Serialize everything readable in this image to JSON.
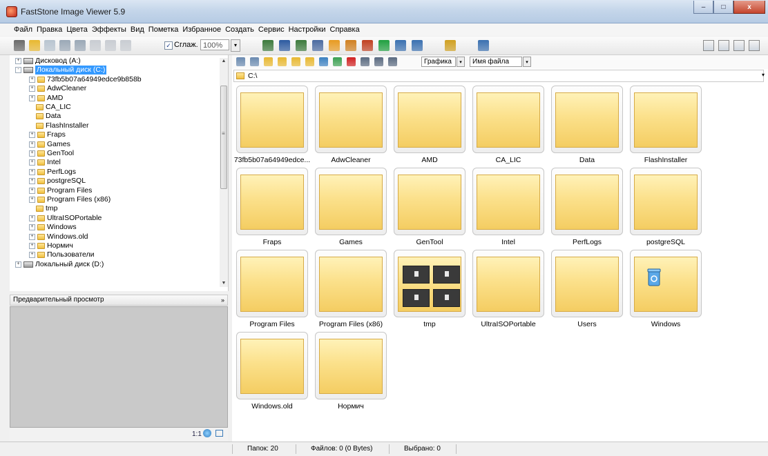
{
  "window": {
    "title": "FastStone Image Viewer 5.9"
  },
  "window_controls": {
    "minimize": "–",
    "maximize": "□",
    "close": "x"
  },
  "menu": [
    "Файл",
    "Правка",
    "Цвета",
    "Эффекты",
    "Вид",
    "Пометка",
    "Избранное",
    "Создать",
    "Сервис",
    "Настройки",
    "Справка"
  ],
  "toolbar": {
    "smooth_check": "✓",
    "smooth_label": "Сглаж.",
    "zoom_value": "100%",
    "dropdown_arrow": "▾"
  },
  "tree": {
    "items": [
      {
        "label": "Дисковод (A:)",
        "type": "drive",
        "indent": 0,
        "expander": "+"
      },
      {
        "label": "Локальный диск (C:)",
        "type": "drive",
        "indent": 0,
        "expander": "-",
        "selected": true
      },
      {
        "label": "73fb5b07a64949edce9b858b",
        "type": "folder",
        "indent": 1,
        "expander": "+"
      },
      {
        "label": "AdwCleaner",
        "type": "folder",
        "indent": 1,
        "expander": "+"
      },
      {
        "label": "AMD",
        "type": "folder",
        "indent": 1,
        "expander": "+"
      },
      {
        "label": "CA_LIC",
        "type": "folder",
        "indent": 1,
        "expander": ""
      },
      {
        "label": "Data",
        "type": "folder",
        "indent": 1,
        "expander": ""
      },
      {
        "label": "FlashInstaller",
        "type": "folder",
        "indent": 1,
        "expander": ""
      },
      {
        "label": "Fraps",
        "type": "folder",
        "indent": 1,
        "expander": "+"
      },
      {
        "label": "Games",
        "type": "folder",
        "indent": 1,
        "expander": "+"
      },
      {
        "label": "GenTool",
        "type": "folder",
        "indent": 1,
        "expander": "+"
      },
      {
        "label": "Intel",
        "type": "folder",
        "indent": 1,
        "expander": "+"
      },
      {
        "label": "PerfLogs",
        "type": "folder",
        "indent": 1,
        "expander": "+"
      },
      {
        "label": "postgreSQL",
        "type": "folder",
        "indent": 1,
        "expander": "+"
      },
      {
        "label": "Program Files",
        "type": "folder",
        "indent": 1,
        "expander": "+"
      },
      {
        "label": "Program Files (x86)",
        "type": "folder",
        "indent": 1,
        "expander": "+"
      },
      {
        "label": "tmp",
        "type": "folder",
        "indent": 1,
        "expander": ""
      },
      {
        "label": "UltraISOPortable",
        "type": "folder",
        "indent": 1,
        "expander": "+"
      },
      {
        "label": "Windows",
        "type": "folder",
        "indent": 1,
        "expander": "+"
      },
      {
        "label": "Windows.old",
        "type": "folder",
        "indent": 1,
        "expander": "+"
      },
      {
        "label": "Нормич",
        "type": "folder",
        "indent": 1,
        "expander": "+"
      },
      {
        "label": "Пользователи",
        "type": "folder",
        "indent": 1,
        "expander": "+"
      },
      {
        "label": "Локальный диск (D:)",
        "type": "drive",
        "indent": 0,
        "expander": "+"
      }
    ],
    "scroll_up": "▲",
    "scroll_down": "▼",
    "scroll_grip": "≡"
  },
  "preview": {
    "title": "Предварительный просмотр",
    "collapse_icon": "»",
    "actual_size": "1:1"
  },
  "browser": {
    "sort_type": "Графика",
    "sort_field": "Имя файла",
    "path": "C:\\",
    "folders": [
      {
        "name": "73fb5b07a64949edce...",
        "kind": "folder"
      },
      {
        "name": "AdwCleaner",
        "kind": "folder"
      },
      {
        "name": "AMD",
        "kind": "folder"
      },
      {
        "name": "CA_LIC",
        "kind": "folder"
      },
      {
        "name": "Data",
        "kind": "folder"
      },
      {
        "name": "FlashInstaller",
        "kind": "folder"
      },
      {
        "name": "Fraps",
        "kind": "folder"
      },
      {
        "name": "Games",
        "kind": "folder"
      },
      {
        "name": "GenTool",
        "kind": "folder"
      },
      {
        "name": "Intel",
        "kind": "folder"
      },
      {
        "name": "PerfLogs",
        "kind": "folder"
      },
      {
        "name": "postgreSQL",
        "kind": "folder"
      },
      {
        "name": "Program Files",
        "kind": "folder"
      },
      {
        "name": "Program Files (x86)",
        "kind": "folder"
      },
      {
        "name": "tmp",
        "kind": "tmp"
      },
      {
        "name": "UltraISOPortable",
        "kind": "folder"
      },
      {
        "name": "Users",
        "kind": "folder"
      },
      {
        "name": "Windows",
        "kind": "recycle"
      },
      {
        "name": "Windows.old",
        "kind": "folder"
      },
      {
        "name": "Нормич",
        "kind": "folder"
      }
    ]
  },
  "status": {
    "folders": "Папок: 20",
    "files": "Файлов: 0 (0 Bytes)",
    "selected": "Выбрано: 0"
  },
  "colors": {
    "selection": "#3399ff",
    "folder": "#f4cd62",
    "title_bar": "#c5d6ea"
  }
}
